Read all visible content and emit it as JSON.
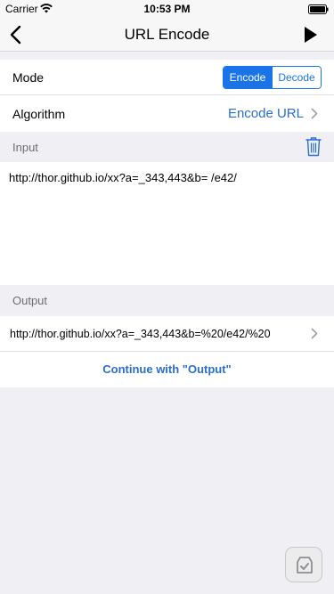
{
  "status_bar": {
    "carrier": "Carrier",
    "time": "10:53 PM"
  },
  "nav": {
    "title": "URL Encode",
    "back_icon": "chevron-left-icon",
    "play_icon": "play-icon"
  },
  "settings": {
    "mode_label": "Mode",
    "mode_options": [
      "Encode",
      "Decode"
    ],
    "mode_selected": "Encode",
    "algorithm_label": "Algorithm",
    "algorithm_value": "Encode URL"
  },
  "input": {
    "header": "Input",
    "text": "http://thor.github.io/xx?a=_343,443&b= /e42/"
  },
  "output": {
    "header": "Output",
    "text": "http://thor.github.io/xx?a=_343,443&b=%20/e42/%20",
    "continue_label": "Continue with \"Output\""
  },
  "colors": {
    "accent": "#1a74e8",
    "link": "#2a6fc9",
    "background": "#efeff4"
  }
}
